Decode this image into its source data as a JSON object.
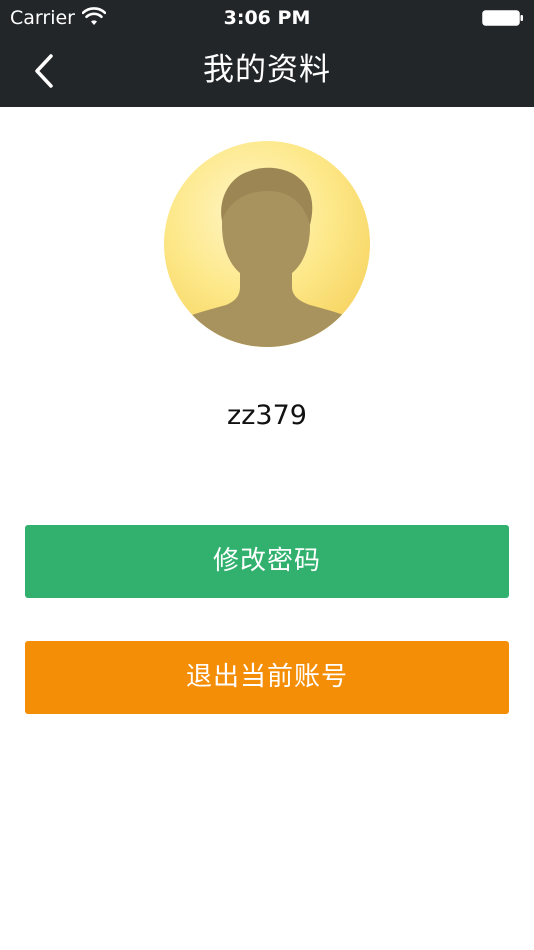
{
  "status_bar": {
    "carrier": "Carrier",
    "time": "3:06 PM",
    "wifi_icon": "wifi-icon",
    "battery_icon": "battery-icon"
  },
  "nav": {
    "title": "我的资料",
    "back_icon": "chevron-left-icon"
  },
  "profile": {
    "avatar_icon": "default-person-silhouette",
    "username": "zz379"
  },
  "actions": {
    "change_password": "修改密码",
    "logout": "退出当前账号"
  },
  "colors": {
    "nav_background": "#222629",
    "primary_green": "#31b16d",
    "warning_orange": "#f58e07",
    "avatar_yellow": "#fde37a"
  }
}
